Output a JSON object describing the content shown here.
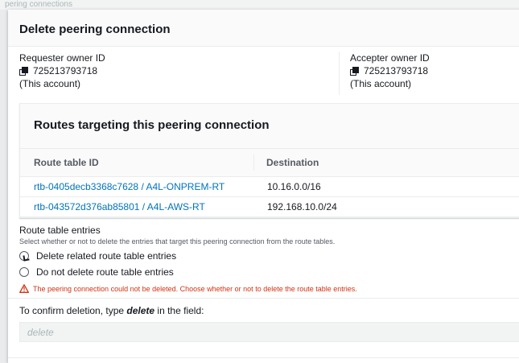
{
  "backdrop": {
    "text": "pering connections"
  },
  "modal": {
    "title": "Delete peering connection",
    "requester": {
      "label": "Requester owner ID",
      "id": "725213793718",
      "note": "(This account)"
    },
    "accepter": {
      "label": "Accepter owner ID",
      "id": "725213793718",
      "note": "(This account)"
    },
    "routes": {
      "title": "Routes targeting this peering connection",
      "columns": [
        "Route table ID",
        "Destination"
      ],
      "rows": [
        {
          "route_table": "rtb-0405decb3368c7628 / A4L-ONPREM-RT",
          "destination": "10.16.0.0/16"
        },
        {
          "route_table": "rtb-043572d376ab85801 / A4L-AWS-RT",
          "destination": "192.168.10.0/24"
        }
      ]
    },
    "entries": {
      "label": "Route table entries",
      "description": "Select whether or not to delete the entries that target this peering connection from the route tables.",
      "options": [
        "Delete related route table entries",
        "Do not delete route table entries"
      ],
      "error": "The peering connection could not be deleted. Choose whether or not to delete the route table entries."
    },
    "confirm": {
      "label_before": "To confirm deletion, type ",
      "label_keyword": "delete",
      "label_after": " in the field:",
      "placeholder": "delete"
    }
  },
  "colors": {
    "link": "#0073bb",
    "error": "#d13212"
  }
}
